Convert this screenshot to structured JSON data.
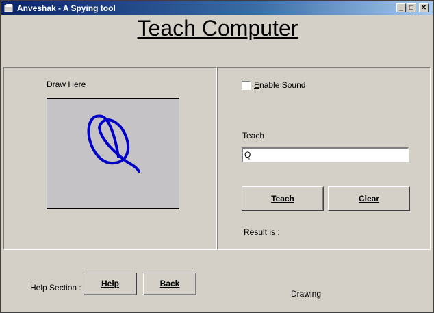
{
  "window": {
    "title": "Anveshak - A Spying tool"
  },
  "heading": "Teach Computer",
  "left_panel": {
    "draw_label": "Draw Here"
  },
  "right_panel": {
    "enable_sound_label": "Enable Sound",
    "enable_sound_checked": false,
    "teach_label": "Teach",
    "teach_input_value": "Q",
    "teach_button": "Teach",
    "clear_button": "Clear",
    "result_label": "Result is :"
  },
  "footer": {
    "help_section_label": "Help Section :",
    "help_button": "Help",
    "back_button": "Back",
    "status": "Drawing"
  },
  "colors": {
    "stroke": "#0000c8",
    "canvas": "#c6c3c6",
    "titlebar": "#0a246a"
  },
  "icons": [
    "app-icon",
    "minimize-icon",
    "maximize-icon",
    "close-icon"
  ]
}
